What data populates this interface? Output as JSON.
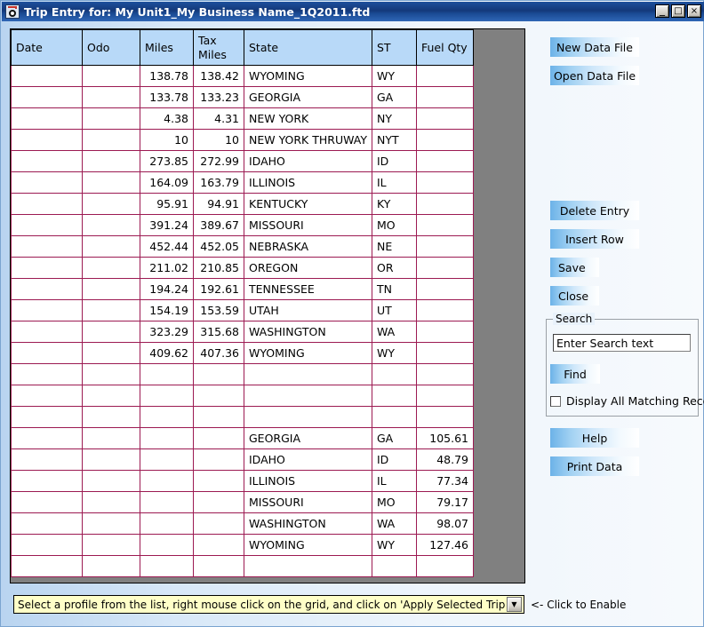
{
  "window": {
    "title": "Trip Entry for: My Unit1_My Business Name_1Q2011.ftd",
    "icon": "trip-entry-icon",
    "minimize_label": "_",
    "maximize_label": "□",
    "close_label": "×"
  },
  "grid": {
    "columns": [
      "Date",
      "Odo",
      "Miles",
      "Tax\nMiles",
      "State",
      "ST",
      "Fuel Qty"
    ],
    "column_headers": {
      "date": "Date",
      "odo": "Odo",
      "miles": "Miles",
      "tax_miles_line1": "Tax",
      "tax_miles_line2": "Miles",
      "state": "State",
      "st": "ST",
      "fuel_qty": "Fuel Qty"
    },
    "rows": [
      {
        "date": "",
        "odo": "",
        "miles": "138.78",
        "tax_miles": "138.42",
        "tax_highlight": true,
        "state": "WYOMING",
        "st": "WY",
        "fuel": ""
      },
      {
        "date": "",
        "odo": "",
        "miles": "133.78",
        "tax_miles": "133.23",
        "tax_highlight": true,
        "state": "GEORGIA",
        "st": "GA",
        "fuel": ""
      },
      {
        "date": "",
        "odo": "",
        "miles": "4.38",
        "tax_miles": "4.31",
        "tax_highlight": true,
        "state": "NEW YORK",
        "st": "NY",
        "fuel": ""
      },
      {
        "date": "",
        "odo": "",
        "miles": "10",
        "tax_miles": "10",
        "tax_highlight": false,
        "state": "NEW YORK THRUWAY",
        "st": "NYT",
        "fuel": ""
      },
      {
        "date": "",
        "odo": "",
        "miles": "273.85",
        "tax_miles": "272.99",
        "tax_highlight": true,
        "state": "IDAHO",
        "st": "ID",
        "fuel": ""
      },
      {
        "date": "",
        "odo": "",
        "miles": "164.09",
        "tax_miles": "163.79",
        "tax_highlight": true,
        "state": "ILLINOIS",
        "st": "IL",
        "fuel": ""
      },
      {
        "date": "",
        "odo": "",
        "miles": "95.91",
        "tax_miles": "94.91",
        "tax_highlight": true,
        "state": "KENTUCKY",
        "st": "KY",
        "fuel": ""
      },
      {
        "date": "",
        "odo": "",
        "miles": "391.24",
        "tax_miles": "389.67",
        "tax_highlight": true,
        "state": "MISSOURI",
        "st": "MO",
        "fuel": ""
      },
      {
        "date": "",
        "odo": "",
        "miles": "452.44",
        "tax_miles": "452.05",
        "tax_highlight": true,
        "state": "NEBRASKA",
        "st": "NE",
        "fuel": ""
      },
      {
        "date": "",
        "odo": "",
        "miles": "211.02",
        "tax_miles": "210.85",
        "tax_highlight": true,
        "state": "OREGON",
        "st": "OR",
        "fuel": ""
      },
      {
        "date": "",
        "odo": "",
        "miles": "194.24",
        "tax_miles": "192.61",
        "tax_highlight": true,
        "state": "TENNESSEE",
        "st": "TN",
        "fuel": ""
      },
      {
        "date": "",
        "odo": "",
        "miles": "154.19",
        "tax_miles": "153.59",
        "tax_highlight": true,
        "state": "UTAH",
        "st": "UT",
        "fuel": ""
      },
      {
        "date": "",
        "odo": "",
        "miles": "323.29",
        "tax_miles": "315.68",
        "tax_highlight": true,
        "state": "WASHINGTON",
        "st": "WA",
        "fuel": ""
      },
      {
        "date": "",
        "odo": "",
        "miles": "409.62",
        "tax_miles": "407.36",
        "tax_highlight": true,
        "state": "WYOMING",
        "st": "WY",
        "fuel": ""
      },
      {
        "date": "",
        "odo": "",
        "miles": "",
        "tax_miles": "",
        "tax_highlight": false,
        "state": "",
        "st": "",
        "fuel": ""
      },
      {
        "date": "",
        "odo": "",
        "miles": "",
        "tax_miles": "",
        "tax_highlight": false,
        "state": "",
        "st": "",
        "fuel": ""
      },
      {
        "date": "",
        "odo": "",
        "miles": "",
        "tax_miles": "",
        "tax_highlight": false,
        "state": "",
        "st": "",
        "fuel": ""
      },
      {
        "date": "",
        "odo": "",
        "miles": "",
        "tax_miles": "",
        "tax_highlight": false,
        "state": "GEORGIA",
        "st": "GA",
        "fuel": "105.61"
      },
      {
        "date": "",
        "odo": "",
        "miles": "",
        "tax_miles": "",
        "tax_highlight": false,
        "state": "IDAHO",
        "st": "ID",
        "fuel": "48.79"
      },
      {
        "date": "",
        "odo": "",
        "miles": "",
        "tax_miles": "",
        "tax_highlight": false,
        "state": "ILLINOIS",
        "st": "IL",
        "fuel": "77.34"
      },
      {
        "date": "",
        "odo": "",
        "miles": "",
        "tax_miles": "",
        "tax_highlight": false,
        "state": "MISSOURI",
        "st": "MO",
        "fuel": "79.17"
      },
      {
        "date": "",
        "odo": "",
        "miles": "",
        "tax_miles": "",
        "tax_highlight": false,
        "state": "WASHINGTON",
        "st": "WA",
        "fuel": "98.07"
      },
      {
        "date": "",
        "odo": "",
        "miles": "",
        "tax_miles": "",
        "tax_highlight": false,
        "state": "WYOMING",
        "st": "WY",
        "fuel": "127.46"
      },
      {
        "date": "",
        "odo": "",
        "miles": "",
        "tax_miles": "",
        "tax_highlight": false,
        "state": "",
        "st": "",
        "fuel": ""
      }
    ]
  },
  "buttons": {
    "new_data_file": "New Data File",
    "open_data_file": "Open Data File",
    "delete_entry": "Delete Entry",
    "insert_row": "Insert Row",
    "save": "Save",
    "close": "Close",
    "help": "Help",
    "print_data": "Print Data"
  },
  "search": {
    "legend": "Search",
    "input_value": "Enter Search text",
    "find_label": "Find",
    "checkbox_label": "Display All Matching Records",
    "checkbox_checked": false
  },
  "bottom": {
    "combo_value": "Select a profile from the list, right mouse click on the grid, and click on 'Apply Selected Trip Profile'.",
    "combo_arrow": "▼",
    "enable_hint": "<- Click to Enable"
  },
  "colors": {
    "title_bar": "#14397a",
    "header_cell": "#b8d9f8",
    "grid_line": "#9c1a52",
    "tax_highlight": "#fdb7b7",
    "filler": "#808080",
    "combo_bg": "#ffffc8",
    "button_accent": "#6cb2e8"
  }
}
